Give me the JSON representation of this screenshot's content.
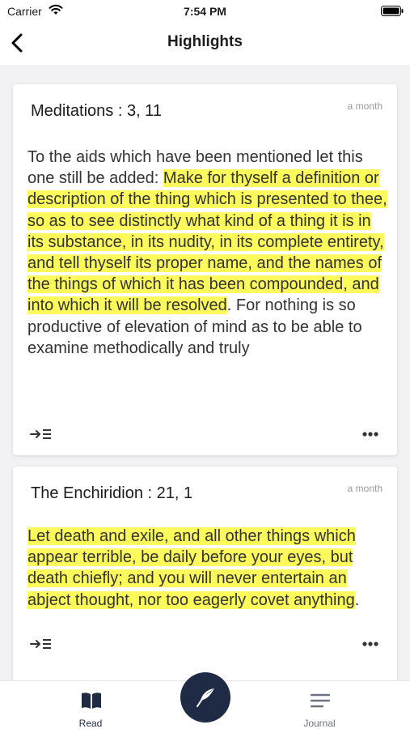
{
  "status_bar": {
    "carrier": "Carrier",
    "time": "7:54 PM"
  },
  "nav": {
    "title": "Highlights"
  },
  "cards": [
    {
      "title": "Meditations : 3, 11",
      "time": "a month",
      "text_before": "To the aids which have been mentioned let this one still be added: ",
      "highlight": "Make for thyself a definition or description of the thing which is presented to thee, so as to see distinctly what kind of a thing it is in its substance, in its nudity, in its complete entirety, and tell thyself its proper name, and the names of the things of which it has been compounded, and into which it will be resolved",
      "text_after": ". For nothing is so productive of elevation of mind as to be able to examine methodically and truly"
    },
    {
      "title": "The Enchiridion : 21, 1",
      "time": "a month",
      "text_before": "",
      "highlight": "Let death and exile, and all other things which appear terrible, be daily before your eyes, but death chiefly; and you will never entertain an abject thought, nor too eagerly covet anything",
      "text_after": "."
    }
  ],
  "tabs": {
    "read": "Read",
    "journal": "Journal"
  },
  "colors": {
    "highlight": "#fdfb5c",
    "accent": "#1f2a44"
  },
  "icons": {
    "back": "chevron-left-icon",
    "goto": "goto-passage-icon",
    "more": "more-horizontal-icon",
    "read": "book-icon",
    "journal": "journal-lines-icon",
    "fab": "quill-icon"
  }
}
